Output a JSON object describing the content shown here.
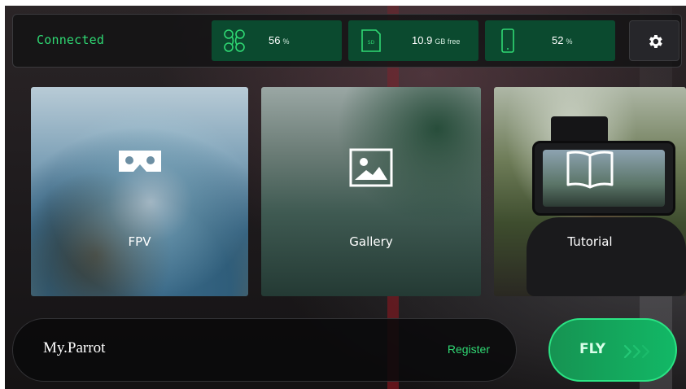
{
  "status_bar": {
    "connection": "Connected",
    "drone_battery": {
      "value": "56",
      "unit": "%",
      "icon": "drone-icon"
    },
    "storage": {
      "value": "10.9",
      "unit": "GB free",
      "icon": "sd-card-icon",
      "icon_text": "SD"
    },
    "phone_battery": {
      "value": "52",
      "unit": "%",
      "icon": "phone-icon"
    },
    "settings_icon": "gear-icon"
  },
  "cards": [
    {
      "label": "FPV",
      "icon": "vr-headset-icon"
    },
    {
      "label": "Gallery",
      "icon": "image-icon"
    },
    {
      "label": "Tutorial",
      "icon": "book-icon"
    }
  ],
  "my_parrot": {
    "brand": "My.Parrot",
    "register": "Register"
  },
  "fly_button": {
    "label": "FLY",
    "icon": "chevrons-right-icon"
  },
  "colors": {
    "accent": "#2fd873",
    "stat_bg": "#0b4a2f",
    "fly": "#12b866"
  }
}
